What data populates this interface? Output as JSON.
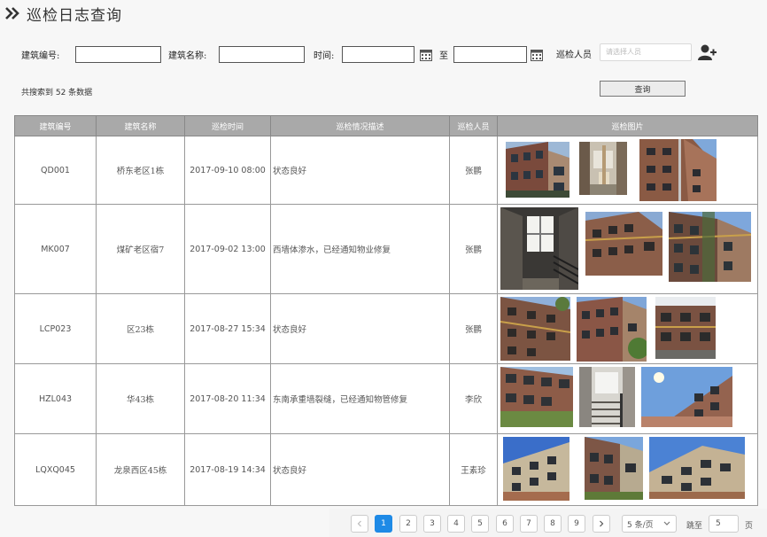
{
  "page": {
    "title": "巡检日志查询"
  },
  "filters": {
    "building_no_label": "建筑编号:",
    "building_name_label": "建筑名称:",
    "time_label": "时间:",
    "to_label": "至",
    "inspector_label": "巡检人员",
    "inspector_placeholder": "请选择人员",
    "query_button": "查询"
  },
  "result_count": "共搜索到 52 条数据",
  "table": {
    "headers": [
      "建筑编号",
      "建筑名称",
      "巡检时间",
      "巡检情况描述",
      "巡检人员",
      "巡检图片"
    ],
    "rows": [
      {
        "code": "QD001",
        "name": "桥东老区1栋",
        "time": "2017-09-10 08:00",
        "desc": "状态良好",
        "person": "张鹏"
      },
      {
        "code": "MK007",
        "name": "煤矿老区宿7",
        "time": "2017-09-02 13:00",
        "desc": "西墙体渗水，已经通知物业修复",
        "person": "张鹏"
      },
      {
        "code": "LCP023",
        "name": "区23栋",
        "time": "2017-08-27 15:34",
        "desc": "状态良好",
        "person": "张鹏"
      },
      {
        "code": "HZL043",
        "name": "华43栋",
        "time": "2017-08-20 11:34",
        "desc": "东南承重墙裂缝，已经通知物管修复",
        "person": "李欣"
      },
      {
        "code": "LQXQ045",
        "name": "龙泉西区45栋",
        "time": "2017-08-19 14:34",
        "desc": "状态良好",
        "person": "王素珍"
      }
    ]
  },
  "pagination": {
    "pages": [
      "1",
      "2",
      "3",
      "4",
      "5",
      "6",
      "7",
      "8",
      "9"
    ],
    "current": "1",
    "page_size": "5 条/页",
    "jump_label": "跳至",
    "jump_value": "5",
    "page_suffix": "页"
  },
  "colors": {
    "accent": "#1e8ae6",
    "table_header": "#a9a9a9"
  }
}
